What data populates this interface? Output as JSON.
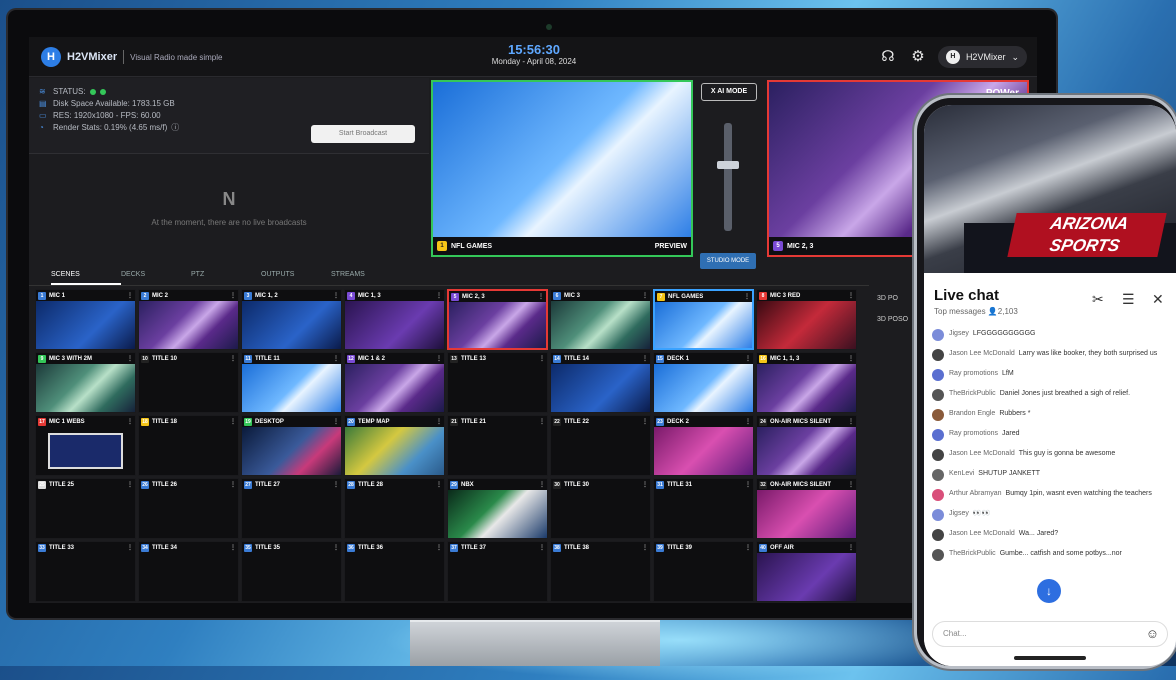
{
  "app": {
    "brand": "H2VMixer",
    "tagline": "Visual Radio made simple",
    "time": "15:56:30",
    "date": "Monday - April 08, 2024",
    "account": "H2VMixer"
  },
  "status": {
    "label": "STATUS:",
    "disk": "Disk Space Available: 1783.15 GB",
    "res": "RES: 1920x1080 - FPS: 60.00",
    "render": "Render Stats: 0.19% (4.65 ms/f)",
    "start_button": "Start Broadcast",
    "no_broadcast": "At the moment, there are no live broadcasts"
  },
  "preview": {
    "num": "1",
    "title": "NFL GAMES",
    "tag": "PREVIEW"
  },
  "program": {
    "num": "5",
    "title": "MIC 2, 3",
    "brand": "POWer"
  },
  "transition": {
    "cut": "X AI MODE",
    "studio": "STUDIO MODE"
  },
  "tabs": [
    "SCENES",
    "DECKS",
    "PTZ",
    "OUTPUTS",
    "STREAMS"
  ],
  "scenes": [
    {
      "n": "1",
      "t": "MIC 1",
      "c": "#3a7bd5",
      "th": "th-blue"
    },
    {
      "n": "2",
      "t": "MIC 2",
      "c": "#3a7bd5",
      "th": "th-studio"
    },
    {
      "n": "3",
      "t": "MIC 1, 2",
      "c": "#3a7bd5",
      "th": "th-blue"
    },
    {
      "n": "4",
      "t": "MIC 1, 3",
      "c": "#7a4bd5",
      "th": "th-purple"
    },
    {
      "n": "5",
      "t": "MIC 2, 3",
      "c": "#7a4bd5",
      "th": "th-studio",
      "cls": "sel"
    },
    {
      "n": "6",
      "t": "MIC 3",
      "c": "#3a7bd5",
      "th": "th-green"
    },
    {
      "n": "7",
      "t": "NFL GAMES",
      "c": "#f5c518",
      "th": "th-power",
      "cls": "prv"
    },
    {
      "n": "8",
      "t": "MIC 3 RED",
      "c": "#e53935",
      "th": "th-red"
    },
    {
      "n": "9",
      "t": "MIC 3 WITH 2M",
      "c": "#34c759",
      "th": "th-green"
    },
    {
      "n": "10",
      "t": "TITLE 10",
      "c": "#222",
      "th": ""
    },
    {
      "n": "11",
      "t": "TITLE 11",
      "c": "#3a7bd5",
      "th": "th-power"
    },
    {
      "n": "12",
      "t": "MIC 1 & 2",
      "c": "#7a4bd5",
      "th": "th-studio"
    },
    {
      "n": "13",
      "t": "TITLE 13",
      "c": "#222",
      "th": ""
    },
    {
      "n": "14",
      "t": "TITLE 14",
      "c": "#3a7bd5",
      "th": "th-blue"
    },
    {
      "n": "15",
      "t": "DECK 1",
      "c": "#3a7bd5",
      "th": "th-power"
    },
    {
      "n": "16",
      "t": "MIC 1, 1, 3",
      "c": "#f5c518",
      "th": "th-studio"
    },
    {
      "n": "17",
      "t": "MIC 1 WEBS",
      "c": "#e53935",
      "th": "th-frame"
    },
    {
      "n": "18",
      "t": "TITLE 18",
      "c": "#f5c518",
      "th": ""
    },
    {
      "n": "19",
      "t": "DESKTOP",
      "c": "#34c759",
      "th": "th-desk"
    },
    {
      "n": "20",
      "t": "TEMP MAP",
      "c": "#3a7bd5",
      "th": "th-map"
    },
    {
      "n": "21",
      "t": "TITLE 21",
      "c": "#222",
      "th": ""
    },
    {
      "n": "22",
      "t": "TITLE 22",
      "c": "#222",
      "th": ""
    },
    {
      "n": "23",
      "t": "DECK 2",
      "c": "#3a7bd5",
      "th": "th-pink"
    },
    {
      "n": "24",
      "t": "ON-AIR MICS SILENT",
      "c": "#222",
      "th": "th-studio"
    },
    {
      "n": "25",
      "t": "TITLE 25",
      "c": "#ddd",
      "th": ""
    },
    {
      "n": "26",
      "t": "TITLE 26",
      "c": "#3a7bd5",
      "th": ""
    },
    {
      "n": "27",
      "t": "TITLE 27",
      "c": "#3a7bd5",
      "th": ""
    },
    {
      "n": "28",
      "t": "TITLE 28",
      "c": "#3a7bd5",
      "th": ""
    },
    {
      "n": "29",
      "t": "NBX",
      "c": "#3a7bd5",
      "th": "th-field"
    },
    {
      "n": "30",
      "t": "TITLE 30",
      "c": "#222",
      "th": ""
    },
    {
      "n": "31",
      "t": "TITLE 31",
      "c": "#3a7bd5",
      "th": ""
    },
    {
      "n": "32",
      "t": "ON-AIR MICS SILENT",
      "c": "#222",
      "th": "th-pink"
    },
    {
      "n": "33",
      "t": "TITLE 33",
      "c": "#3a7bd5",
      "th": ""
    },
    {
      "n": "34",
      "t": "TITLE 34",
      "c": "#3a7bd5",
      "th": ""
    },
    {
      "n": "35",
      "t": "TITLE 35",
      "c": "#3a7bd5",
      "th": ""
    },
    {
      "n": "36",
      "t": "TITLE 36",
      "c": "#3a7bd5",
      "th": ""
    },
    {
      "n": "37",
      "t": "TITLE 37",
      "c": "#3a7bd5",
      "th": ""
    },
    {
      "n": "38",
      "t": "TITLE 38",
      "c": "#3a7bd5",
      "th": ""
    },
    {
      "n": "39",
      "t": "TITLE 39",
      "c": "#3a7bd5",
      "th": ""
    },
    {
      "n": "40",
      "t": "OFF AIR",
      "c": "#3a7bd5",
      "th": "th-purple"
    }
  ],
  "side": {
    "a": "3D PO",
    "b": "3D POSO"
  },
  "chat": {
    "title": "Live chat",
    "subtitle": "Top messages",
    "count": "2,103",
    "placeholder": "Chat...",
    "messages": [
      {
        "u": "Jigsey",
        "m": "LFGGGGGGGGGG",
        "c": "#7b8cd9"
      },
      {
        "u": "Jason Lee McDonald",
        "m": "Larry was like booker, they both surprised us",
        "c": "#444"
      },
      {
        "u": "Ray promotions",
        "m": "LfM",
        "c": "#5a6fd0"
      },
      {
        "u": "TheBrickPublic",
        "m": "Daniel Jones just breathed a sigh of relief.",
        "c": "#555"
      },
      {
        "u": "Brandon Engle",
        "m": "Rubbers *",
        "c": "#8a5a3a"
      },
      {
        "u": "Ray promotions",
        "m": "Jared",
        "c": "#5a6fd0"
      },
      {
        "u": "Jason Lee McDonald",
        "m": "This guy is gonna be awesome",
        "c": "#444"
      },
      {
        "u": "KenLevi",
        "m": "SHUTUP JANKETT",
        "c": "#666"
      },
      {
        "u": "Arthur Abramyan",
        "m": "Bumqy 1pin, wasnt even watching the teachers",
        "c": "#d94f7a"
      },
      {
        "u": "Jigsey",
        "m": "👀👀",
        "c": "#7b8cd9"
      },
      {
        "u": "Jason Lee McDonald",
        "m": "Wa... Jared?",
        "c": "#444"
      },
      {
        "u": "TheBrickPublic",
        "m": "Gumbe... catfish and some potbys...nor",
        "c": "#555"
      }
    ]
  },
  "video": {
    "banner1": "ARIZONA",
    "banner2": "SPORTS"
  }
}
